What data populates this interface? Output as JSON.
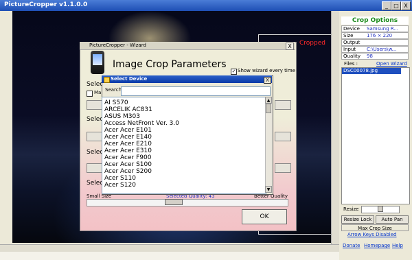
{
  "main": {
    "title": "PictureCropper v1.1.0.0",
    "min": "_",
    "max": "□",
    "close": "X"
  },
  "photo": {
    "cropped_label": "Cropped"
  },
  "panel": {
    "header": "Crop Options",
    "rows": [
      {
        "label": "Device",
        "value": "Samsung R..."
      },
      {
        "label": "Size",
        "value": "176 × 220"
      },
      {
        "label": "Output",
        "value": ""
      },
      {
        "label": "Input",
        "value": "C:\\Users\\w..."
      },
      {
        "label": "Quality",
        "value": "98"
      }
    ],
    "files_label": "Files :",
    "open_wizard": "Open Wizard",
    "file_item": "DSC00078.jpg",
    "resize_label": "Resize",
    "resize_lock": "Resize Lock",
    "auto_pan": "Auto Pan",
    "max_crop": "Max Crop Size",
    "arrow_keys": "Arrow Keys Disabled",
    "donate": "Donate",
    "homepage": "Homepage",
    "help": "Help"
  },
  "wizard": {
    "title": "PictureCropper - Wizard",
    "close": "X",
    "heading": "Image Crop Parameters",
    "show_wizard": "Show wizard every time",
    "show_wizard_checked": "✓",
    "partial_labels": [
      "Select",
      "Ma",
      "Selec",
      "Selec",
      "Selec"
    ],
    "small_size": "Small Size",
    "selected_quality": "Selected Quality: 43",
    "better_quality": "Better Quality",
    "ok": "OK"
  },
  "device_dialog": {
    "title": "Select Device",
    "close": "X",
    "search_label": "Search",
    "search_value": "",
    "devices": [
      "AI S570",
      "ARCELIK AC831",
      "ASUS M303",
      "Access NetFront Ver. 3.0",
      "Acer Acer E101",
      "Acer Acer E140",
      "Acer Acer E210",
      "Acer Acer E310",
      "Acer Acer F900",
      "Acer Acer S100",
      "Acer Acer S200",
      "Acer S110",
      "Acer S120"
    ]
  }
}
